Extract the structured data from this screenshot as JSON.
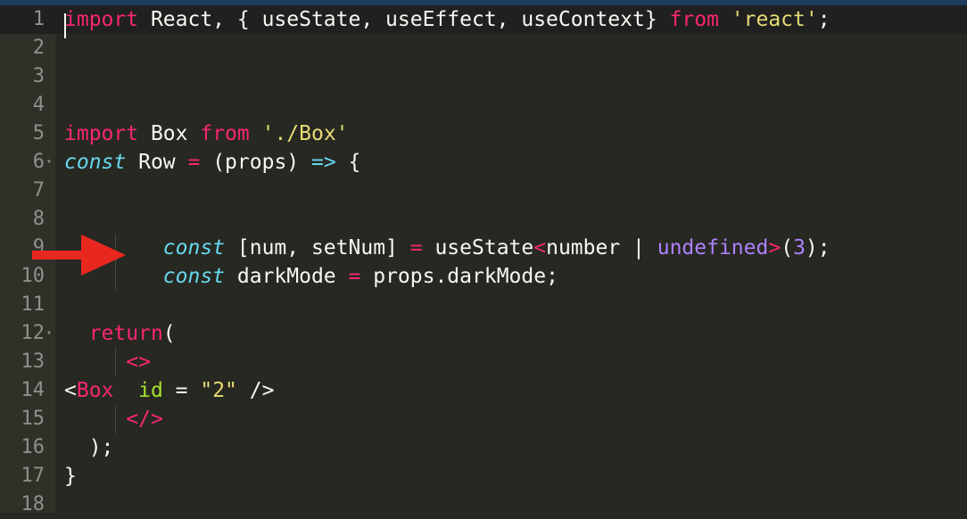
{
  "editor": {
    "theme_colors": {
      "background": "#272822",
      "keyword": "#f92672",
      "string": "#e6db74",
      "storage": "#66d9ef",
      "constant": "#ae81ff",
      "attribute": "#a6e22e",
      "plain": "#f8f8f2",
      "line_number": "#8f908a",
      "arrow": "#e8271f"
    },
    "lines": [
      {
        "num": "1",
        "tokens": [
          {
            "t": "import",
            "c": "kw"
          },
          {
            "t": " React, { useState, useEffect, useContext} ",
            "c": "pl"
          },
          {
            "t": "from",
            "c": "kw"
          },
          {
            "t": " ",
            "c": "pl"
          },
          {
            "t": "'react'",
            "c": "st"
          },
          {
            "t": ";",
            "c": "pl"
          }
        ]
      },
      {
        "num": "2",
        "tokens": []
      },
      {
        "num": "3",
        "tokens": []
      },
      {
        "num": "4",
        "tokens": []
      },
      {
        "num": "5",
        "tokens": [
          {
            "t": "import",
            "c": "kw"
          },
          {
            "t": " Box ",
            "c": "pl"
          },
          {
            "t": "from",
            "c": "kw"
          },
          {
            "t": " ",
            "c": "pl"
          },
          {
            "t": "'./Box'",
            "c": "st"
          }
        ]
      },
      {
        "num": "6",
        "fold": true,
        "tokens": [
          {
            "t": "const",
            "c": "it"
          },
          {
            "t": " Row ",
            "c": "pl"
          },
          {
            "t": "=",
            "c": "kw"
          },
          {
            "t": " (props) ",
            "c": "pl"
          },
          {
            "t": "=>",
            "c": "it"
          },
          {
            "t": " {",
            "c": "pl"
          }
        ]
      },
      {
        "num": "7",
        "tokens": []
      },
      {
        "num": "8",
        "tokens": []
      },
      {
        "num": "9",
        "tokens": [
          {
            "t": "        ",
            "c": "pl"
          },
          {
            "t": "const",
            "c": "it"
          },
          {
            "t": " [num, setNum] ",
            "c": "pl"
          },
          {
            "t": "=",
            "c": "kw"
          },
          {
            "t": " useState",
            "c": "pl"
          },
          {
            "t": "<",
            "c": "kw"
          },
          {
            "t": "number | ",
            "c": "pl"
          },
          {
            "t": "undefined",
            "c": "pu"
          },
          {
            "t": ">",
            "c": "kw"
          },
          {
            "t": "(",
            "c": "pl"
          },
          {
            "t": "3",
            "c": "pu"
          },
          {
            "t": ");",
            "c": "pl"
          }
        ]
      },
      {
        "num": "10",
        "tokens": [
          {
            "t": "        ",
            "c": "pl"
          },
          {
            "t": "const",
            "c": "it"
          },
          {
            "t": " darkMode ",
            "c": "pl"
          },
          {
            "t": "=",
            "c": "kw"
          },
          {
            "t": " props.darkMode;",
            "c": "pl"
          }
        ]
      },
      {
        "num": "11",
        "tokens": []
      },
      {
        "num": "12",
        "fold": true,
        "tokens": [
          {
            "t": "  ",
            "c": "pl"
          },
          {
            "t": "return",
            "c": "kw"
          },
          {
            "t": "(",
            "c": "pl"
          }
        ]
      },
      {
        "num": "13",
        "tokens": [
          {
            "t": "     ",
            "c": "pl"
          },
          {
            "t": "<>",
            "c": "kw"
          }
        ]
      },
      {
        "num": "14",
        "tokens": [
          {
            "t": "<",
            "c": "pl"
          },
          {
            "t": "Box",
            "c": "kw"
          },
          {
            "t": "  ",
            "c": "pl"
          },
          {
            "t": "id",
            "c": "gr"
          },
          {
            "t": " = ",
            "c": "pl"
          },
          {
            "t": "\"2\"",
            "c": "st"
          },
          {
            "t": " />",
            "c": "pl"
          }
        ]
      },
      {
        "num": "15",
        "tokens": [
          {
            "t": "     ",
            "c": "pl"
          },
          {
            "t": "</>",
            "c": "kw"
          }
        ]
      },
      {
        "num": "16",
        "tokens": [
          {
            "t": "  );",
            "c": "pl"
          }
        ]
      },
      {
        "num": "17",
        "tokens": [
          {
            "t": "}",
            "c": "pl"
          }
        ]
      },
      {
        "num": "18",
        "tokens": []
      }
    ]
  },
  "annotation": {
    "icon": "red-arrow-icon"
  }
}
